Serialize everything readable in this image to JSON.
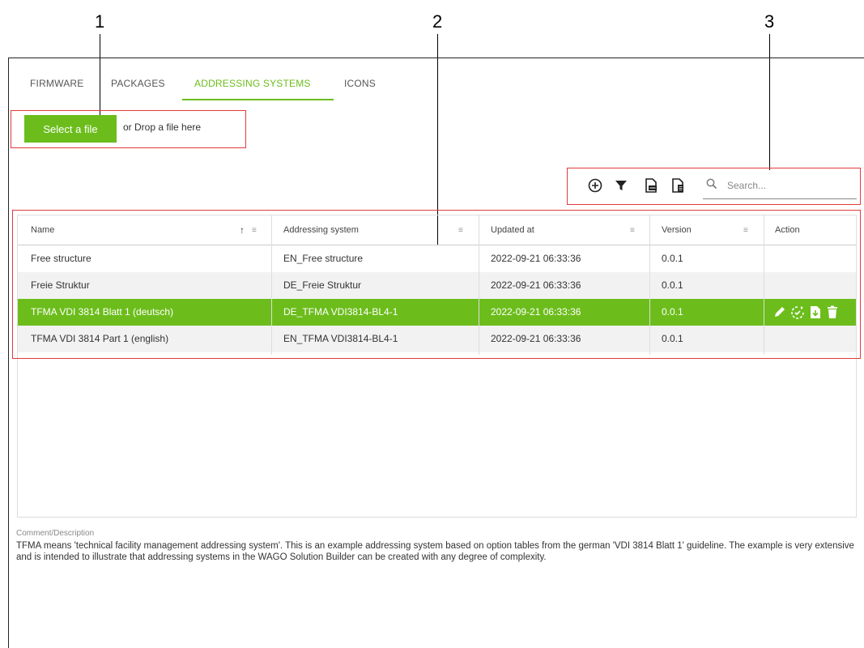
{
  "callouts": [
    "1",
    "2",
    "3"
  ],
  "tabs": [
    {
      "label": "FIRMWARE",
      "active": false
    },
    {
      "label": "PACKAGES",
      "active": false
    },
    {
      "label": "ADDRESSING SYSTEMS",
      "active": true
    },
    {
      "label": "ICONS",
      "active": false
    }
  ],
  "upload": {
    "select_label": "Select a file",
    "drop_label": "or Drop a file here"
  },
  "toolbar": {
    "icons": [
      "add-circle-icon",
      "filter-icon",
      "export-file-icon",
      "document-view-icon"
    ],
    "search_placeholder": "Search..."
  },
  "table": {
    "columns": [
      {
        "label": "Name",
        "sort": "ascending"
      },
      {
        "label": "Addressing system"
      },
      {
        "label": "Updated at"
      },
      {
        "label": "Version"
      },
      {
        "label": "Action"
      }
    ],
    "rows": [
      {
        "name": "Free structure",
        "system": "EN_Free structure",
        "updated": "2022-09-21 06:33:36",
        "version": "0.0.1",
        "selected": false
      },
      {
        "name": "Freie Struktur",
        "system": "DE_Freie Struktur",
        "updated": "2022-09-21 06:33:36",
        "version": "0.0.1",
        "selected": false
      },
      {
        "name": "TFMA VDI 3814 Blatt 1 (deutsch)",
        "system": "DE_TFMA VDI3814-BL4-1",
        "updated": "2022-09-21 06:33:36",
        "version": "0.0.1",
        "selected": true
      },
      {
        "name": "TFMA VDI 3814 Part 1 (english)",
        "system": "EN_TFMA VDI3814-BL4-1",
        "updated": "2022-09-21 06:33:36",
        "version": "0.0.1",
        "selected": false
      }
    ],
    "row_actions": [
      "edit-icon",
      "sync-icon",
      "download-icon",
      "delete-icon"
    ]
  },
  "comment": {
    "label": "Comment/Description",
    "text": "TFMA means 'technical facility management addressing system'. This is an example addressing system based on option tables from the german 'VDI 3814 Blatt 1' guideline. The example is very extensive and is intended to illustrate that addressing systems in the WAGO Solution Builder can be created with any degree of complexity."
  },
  "colors": {
    "accent": "#6cbd1c",
    "callout_box": "#e23b3b",
    "row_stripe": "#f2f2f2"
  }
}
